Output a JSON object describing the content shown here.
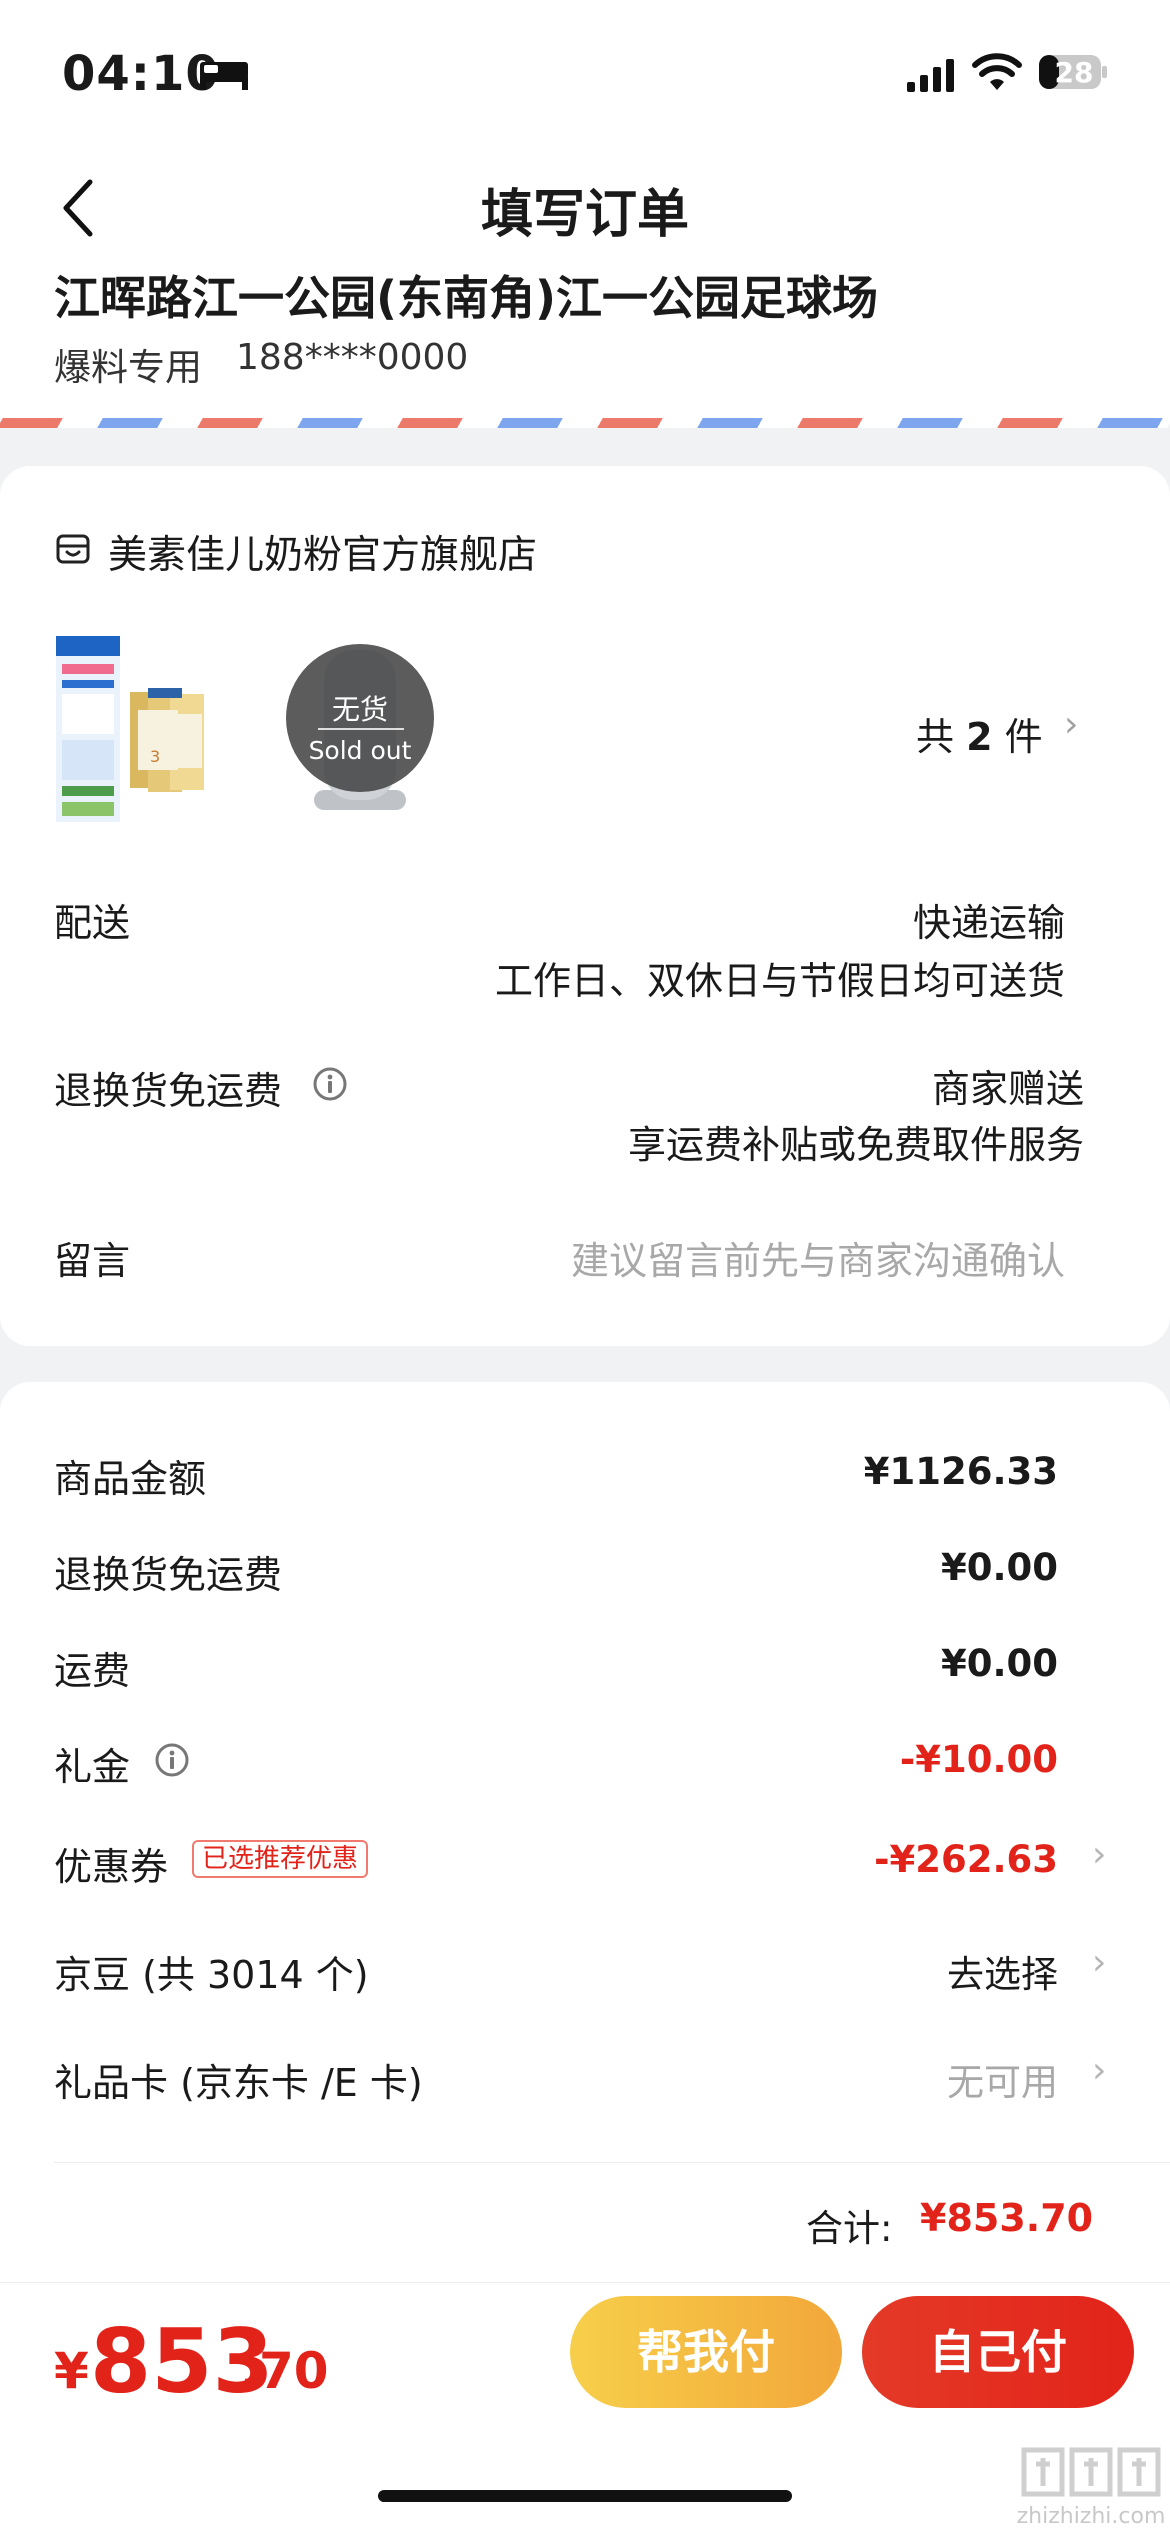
{
  "status_bar": {
    "time": "04:10",
    "battery": "28",
    "icons": [
      "bed-icon",
      "signal-icon",
      "wifi-icon",
      "battery-icon"
    ]
  },
  "header": {
    "title": "填写订单",
    "back_icon": "chevron-left-icon"
  },
  "address": {
    "line": "江晖路江一公园(东南角)江一公园足球场",
    "contact_name": "爆料专用",
    "phone": "188****0000"
  },
  "store": {
    "name": "美素佳儿奶粉官方旗舰店",
    "icon": "store-icon",
    "sold_out_cn": "无货",
    "sold_out_en": "Sold out",
    "count_prefix": "共",
    "count": "2",
    "count_suffix": "件",
    "delivery": {
      "label": "配送",
      "method": "快递运输",
      "note": "工作日、双休日与节假日均可送货"
    },
    "return_shipping": {
      "label": "退换货免运费",
      "value": "商家赠送",
      "note": "享运费补贴或免费取件服务"
    },
    "message": {
      "label": "留言",
      "placeholder": "建议留言前先与商家沟通确认"
    }
  },
  "fees": {
    "goods_amount": {
      "label": "商品金额",
      "value": "¥1126.33"
    },
    "return_fee": {
      "label": "退换货免运费",
      "value": "¥0.00"
    },
    "shipping": {
      "label": "运费",
      "value": "¥0.00"
    },
    "gift_money": {
      "label": "礼金",
      "value": "-¥10.00"
    },
    "coupon": {
      "label": "优惠券",
      "badge": "已选推荐优惠",
      "value": "-¥262.63"
    },
    "jingdou": {
      "label": "京豆 (共 3014 个)",
      "value": "去选择"
    },
    "gift_card": {
      "label": "礼品卡 (京东卡 /E 卡)",
      "value": "无可用"
    },
    "total_label": "合计:",
    "total_value": "¥853.70"
  },
  "bottom_bar": {
    "currency": "¥",
    "price_int": "853",
    "price_dec": ".70",
    "help_pay": "帮我付",
    "self_pay": "自己付"
  },
  "watermark": "zhizhizhi.com",
  "colors": {
    "accent_red": "#e2231a",
    "gold_start": "#f7cf4a",
    "gold_end": "#f2a73a",
    "background": "#f1f2f4"
  }
}
